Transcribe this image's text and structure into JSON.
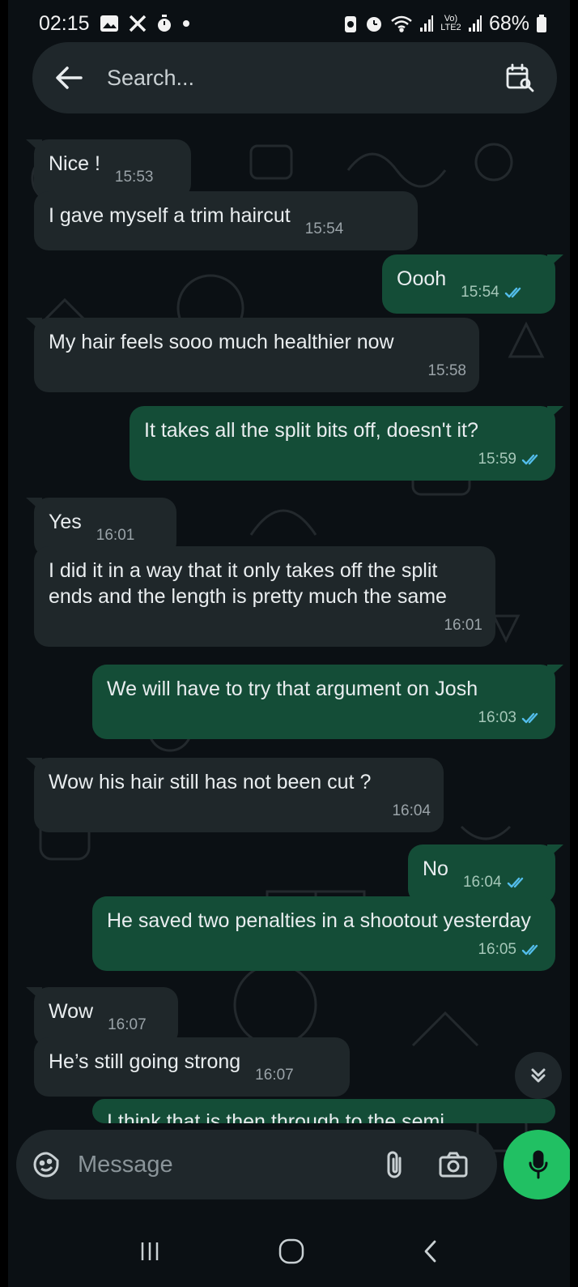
{
  "status_bar": {
    "time": "02:15",
    "battery": "68%",
    "network_label": "Vo) LTE2"
  },
  "search": {
    "placeholder": "Search..."
  },
  "messages": [
    {
      "direction": "in",
      "text": "Nice !",
      "time": "15:53"
    },
    {
      "direction": "in",
      "text": "I gave myself a trim haircut",
      "time": "15:54"
    },
    {
      "direction": "out",
      "text": "Oooh",
      "time": "15:54",
      "read": true
    },
    {
      "direction": "in",
      "text": "My hair feels sooo much healthier now",
      "time": "15:58"
    },
    {
      "direction": "out",
      "text": "It takes all the split bits off, doesn't it?",
      "time": "15:59",
      "read": true
    },
    {
      "direction": "in",
      "text": "Yes",
      "time": "16:01"
    },
    {
      "direction": "in",
      "text": "I did it in a way that it only takes off the split ends and the length is pretty much the same",
      "time": "16:01"
    },
    {
      "direction": "out",
      "text": "We will have to try that argument on Josh",
      "time": "16:03",
      "read": true
    },
    {
      "direction": "in",
      "text": "Wow his hair still has not been cut ?",
      "time": "16:04"
    },
    {
      "direction": "out",
      "text": "No",
      "time": "16:04",
      "read": true
    },
    {
      "direction": "out",
      "text": "He saved two penalties in a shootout yesterday",
      "time": "16:05",
      "read": true
    },
    {
      "direction": "in",
      "text": "Wow",
      "time": "16:07"
    },
    {
      "direction": "in",
      "text": "He’s still going strong",
      "time": "16:07"
    },
    {
      "direction": "out",
      "text": "I think that is then through to the semi",
      "time": "",
      "read": false
    }
  ],
  "composer": {
    "placeholder": "Message"
  },
  "colors": {
    "incoming_bubble": "#1f272a",
    "outgoing_bubble": "#144d37",
    "accent_green": "#21c063",
    "read_tick": "#53bdeb"
  },
  "icons": {
    "back": "arrow-left-icon",
    "calendar_search": "calendar-search-icon",
    "sticker": "sticker-icon",
    "attach": "paperclip-icon",
    "camera": "camera-icon",
    "mic": "mic-icon",
    "scroll_down": "double-chevron-down-icon"
  }
}
